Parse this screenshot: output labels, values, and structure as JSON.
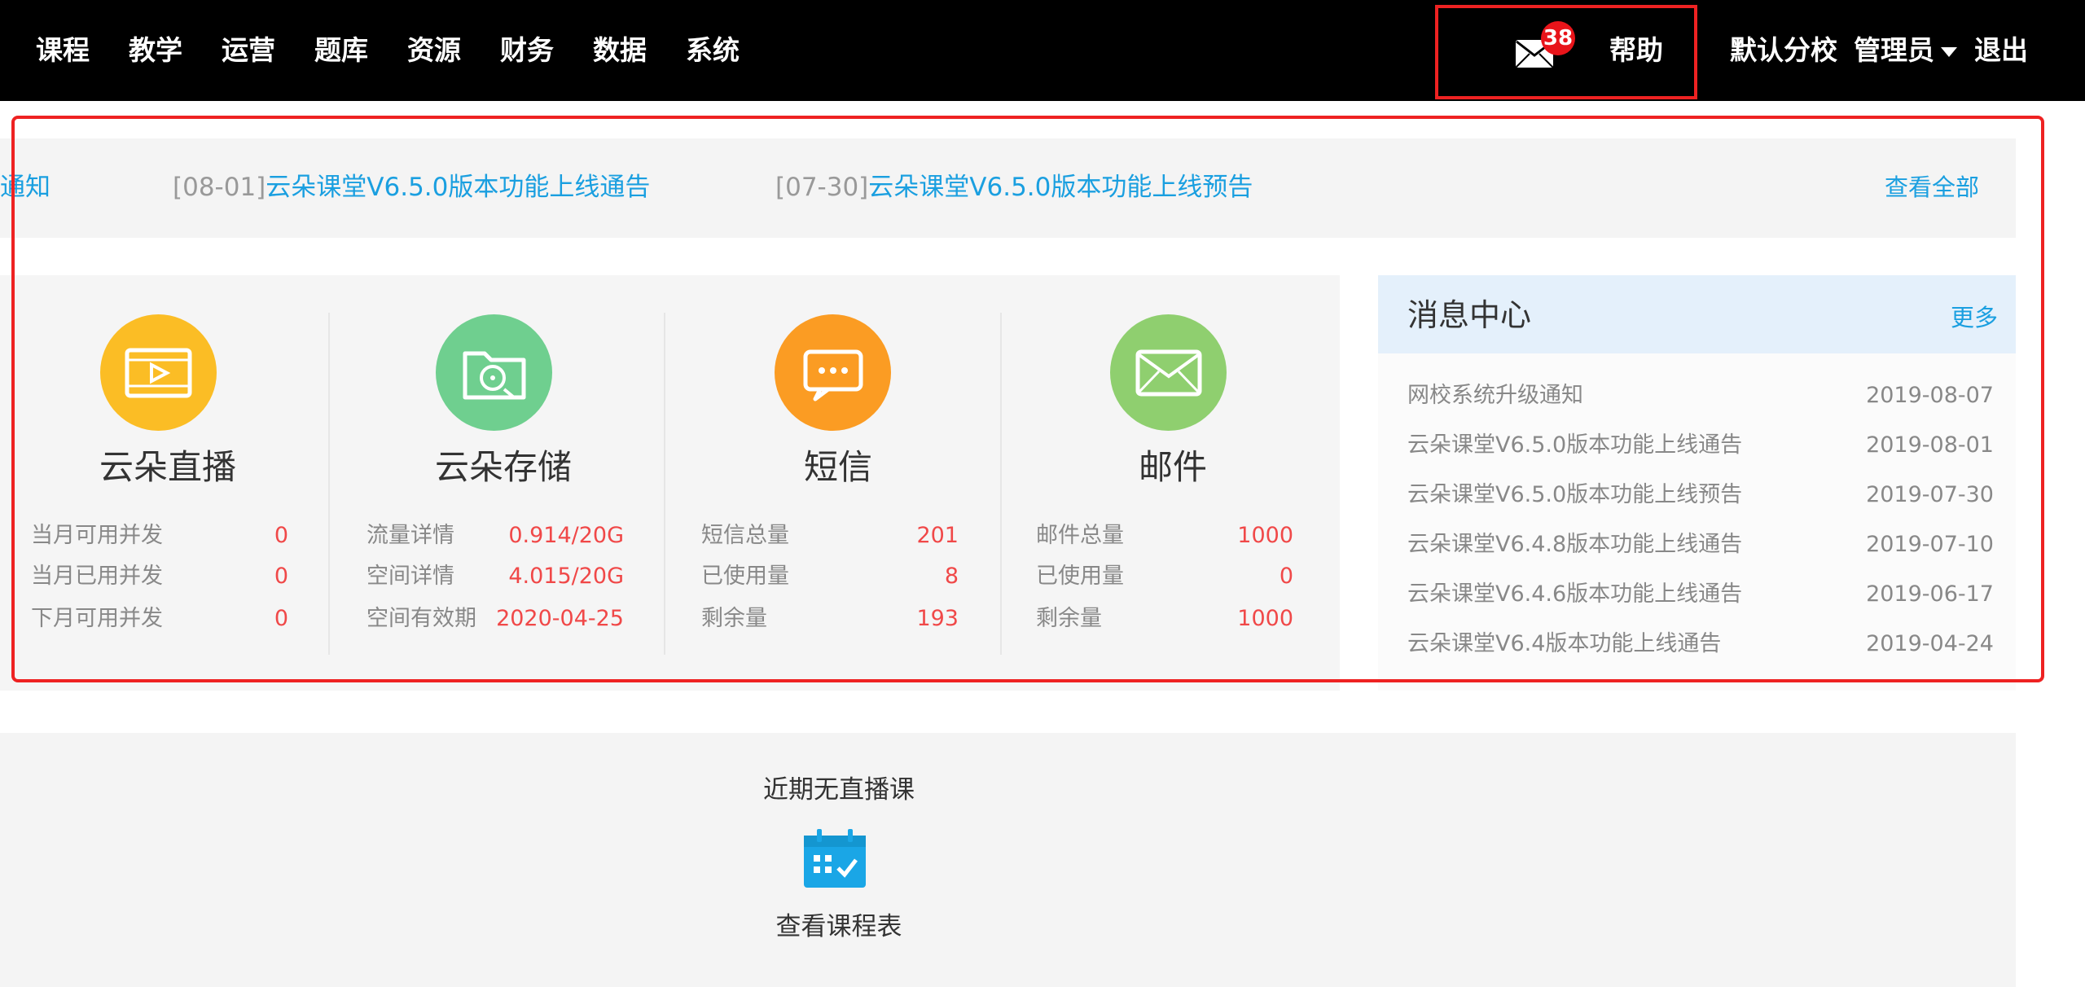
{
  "nav": {
    "items": [
      "课程",
      "教学",
      "运营",
      "题库",
      "资源",
      "财务",
      "数据",
      "系统"
    ]
  },
  "header": {
    "mail_badge": "38",
    "help_label": "帮助",
    "branch_label": "默认分校",
    "user_label": "管理员",
    "logout_label": "退出"
  },
  "notices": {
    "partial_prefix": "通知",
    "items": [
      {
        "date": "[08-01]",
        "title": "云朵课堂V6.5.0版本功能上线通告"
      },
      {
        "date": "[07-30]",
        "title": "云朵课堂V6.5.0版本功能上线预告"
      }
    ],
    "view_all": "查看全部"
  },
  "stats": [
    {
      "title": "云朵直播",
      "icon": "video-icon",
      "color": "#fbbd25",
      "rows": [
        {
          "label": "当月可用并发",
          "value": "0"
        },
        {
          "label": "当月已用并发",
          "value": "0"
        },
        {
          "label": "下月可用并发",
          "value": "0"
        }
      ]
    },
    {
      "title": "云朵存储",
      "icon": "folder-film-icon",
      "color": "#6fcf8f",
      "rows": [
        {
          "label": "流量详情",
          "value": "0.914/20G"
        },
        {
          "label": "空间详情",
          "value": "4.015/20G"
        },
        {
          "label": "空间有效期",
          "value": "2020-04-25"
        }
      ]
    },
    {
      "title": "短信",
      "icon": "chat-icon",
      "color": "#fb9c23",
      "rows": [
        {
          "label": "短信总量",
          "value": "201"
        },
        {
          "label": "已使用量",
          "value": "8"
        },
        {
          "label": "剩余量",
          "value": "193"
        }
      ]
    },
    {
      "title": "邮件",
      "icon": "mail-icon",
      "color": "#8fcf6f",
      "rows": [
        {
          "label": "邮件总量",
          "value": "1000"
        },
        {
          "label": "已使用量",
          "value": "0"
        },
        {
          "label": "剩余量",
          "value": "1000"
        }
      ]
    }
  ],
  "messages": {
    "title": "消息中心",
    "more": "更多",
    "items": [
      {
        "title": "网校系统升级通知",
        "date": "2019-08-07"
      },
      {
        "title": "云朵课堂V6.5.0版本功能上线通告",
        "date": "2019-08-01"
      },
      {
        "title": "云朵课堂V6.5.0版本功能上线预告",
        "date": "2019-07-30"
      },
      {
        "title": "云朵课堂V6.4.8版本功能上线通告",
        "date": "2019-07-10"
      },
      {
        "title": "云朵课堂V6.4.6版本功能上线通告",
        "date": "2019-06-17"
      },
      {
        "title": "云朵课堂V6.4版本功能上线通告",
        "date": "2019-04-24"
      }
    ]
  },
  "live": {
    "empty_text": "近期无直播课",
    "schedule_link": "查看课程表"
  },
  "colors": {
    "accent_blue": "#1a9fe0",
    "value_red": "#f04848",
    "highlight_red": "#ee2222"
  }
}
